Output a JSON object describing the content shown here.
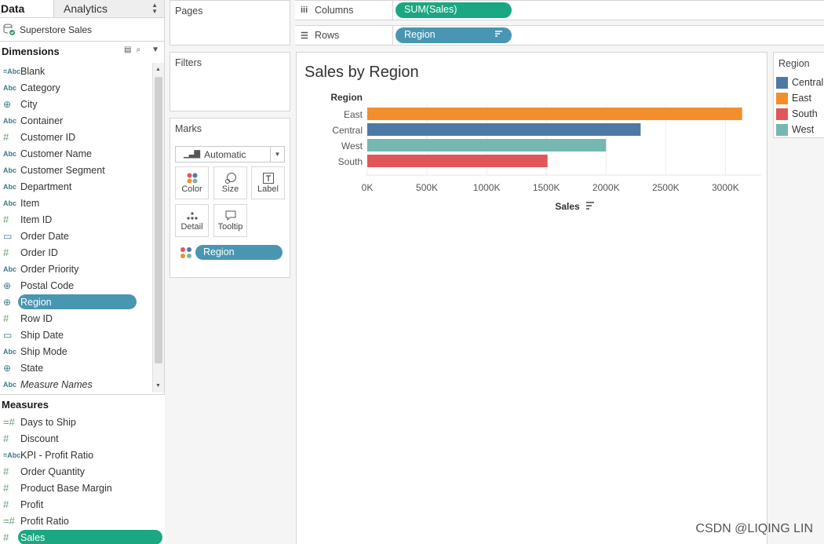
{
  "tabs": {
    "data": "Data",
    "analytics": "Analytics"
  },
  "data_source": "Superstore Sales",
  "dimensions": {
    "title": "Dimensions",
    "fields": [
      {
        "icon": "=Abc",
        "label": "Blank"
      },
      {
        "icon": "Abc",
        "label": "Category"
      },
      {
        "icon": "globe",
        "label": "City"
      },
      {
        "icon": "Abc",
        "label": "Container"
      },
      {
        "icon": "#",
        "label": "Customer ID"
      },
      {
        "icon": "Abc",
        "label": "Customer Name"
      },
      {
        "icon": "Abc",
        "label": "Customer Segment"
      },
      {
        "icon": "Abc",
        "label": "Department"
      },
      {
        "icon": "Abc",
        "label": "Item"
      },
      {
        "icon": "#",
        "label": "Item ID"
      },
      {
        "icon": "cal",
        "label": "Order Date"
      },
      {
        "icon": "#",
        "label": "Order ID"
      },
      {
        "icon": "Abc",
        "label": "Order Priority"
      },
      {
        "icon": "globe",
        "label": "Postal Code"
      },
      {
        "icon": "globe",
        "label": "Region",
        "selected": true
      },
      {
        "icon": "#",
        "label": "Row ID"
      },
      {
        "icon": "cal",
        "label": "Ship Date"
      },
      {
        "icon": "Abc",
        "label": "Ship Mode"
      },
      {
        "icon": "globe",
        "label": "State"
      },
      {
        "icon": "Abc",
        "label": "Measure Names",
        "italic": true
      }
    ]
  },
  "measures": {
    "title": "Measures",
    "fields": [
      {
        "icon": "=#",
        "label": "Days to Ship"
      },
      {
        "icon": "#",
        "label": "Discount"
      },
      {
        "icon": "=Abc",
        "label": "KPI - Profit Ratio"
      },
      {
        "icon": "#",
        "label": "Order Quantity"
      },
      {
        "icon": "#",
        "label": "Product Base Margin"
      },
      {
        "icon": "#",
        "label": "Profit"
      },
      {
        "icon": "=#",
        "label": "Profit Ratio"
      },
      {
        "icon": "#",
        "label": "Sales",
        "selected": true
      }
    ]
  },
  "cards": {
    "pages": "Pages",
    "filters": "Filters",
    "marks": {
      "title": "Marks",
      "mark_type": "Automatic",
      "buttons": {
        "color": "Color",
        "size": "Size",
        "label": "Label",
        "detail": "Detail",
        "tooltip": "Tooltip"
      },
      "color_field": "Region"
    }
  },
  "shelves": {
    "columns": {
      "label": "Columns",
      "pill": "SUM(Sales)"
    },
    "rows": {
      "label": "Rows",
      "pill": "Region"
    }
  },
  "view": {
    "title": "Sales by Region"
  },
  "colors": {
    "Central": "#4e79a7",
    "East": "#f28e2b",
    "South": "#e15759",
    "West": "#76b7b2",
    "measure_pill": "#1ba781",
    "dimension_pill": "#4996b2"
  },
  "chart_data": {
    "type": "bar",
    "orientation": "horizontal",
    "categories": [
      "East",
      "Central",
      "West",
      "South"
    ],
    "values": [
      3140000,
      2290000,
      2000000,
      1510000
    ],
    "ylabel": "Region",
    "xlabel": "Sales",
    "xlim": [
      0,
      3300000
    ],
    "xticks": [
      0,
      500000,
      1000000,
      1500000,
      2000000,
      2500000,
      3000000
    ],
    "xtick_labels": [
      "0K",
      "500K",
      "1000K",
      "1500K",
      "2000K",
      "2500K",
      "3000K"
    ],
    "grid": true
  },
  "legend": {
    "title": "Region",
    "items": [
      "Central",
      "East",
      "South",
      "West"
    ]
  },
  "watermark": "CSDN @LIQING LIN"
}
